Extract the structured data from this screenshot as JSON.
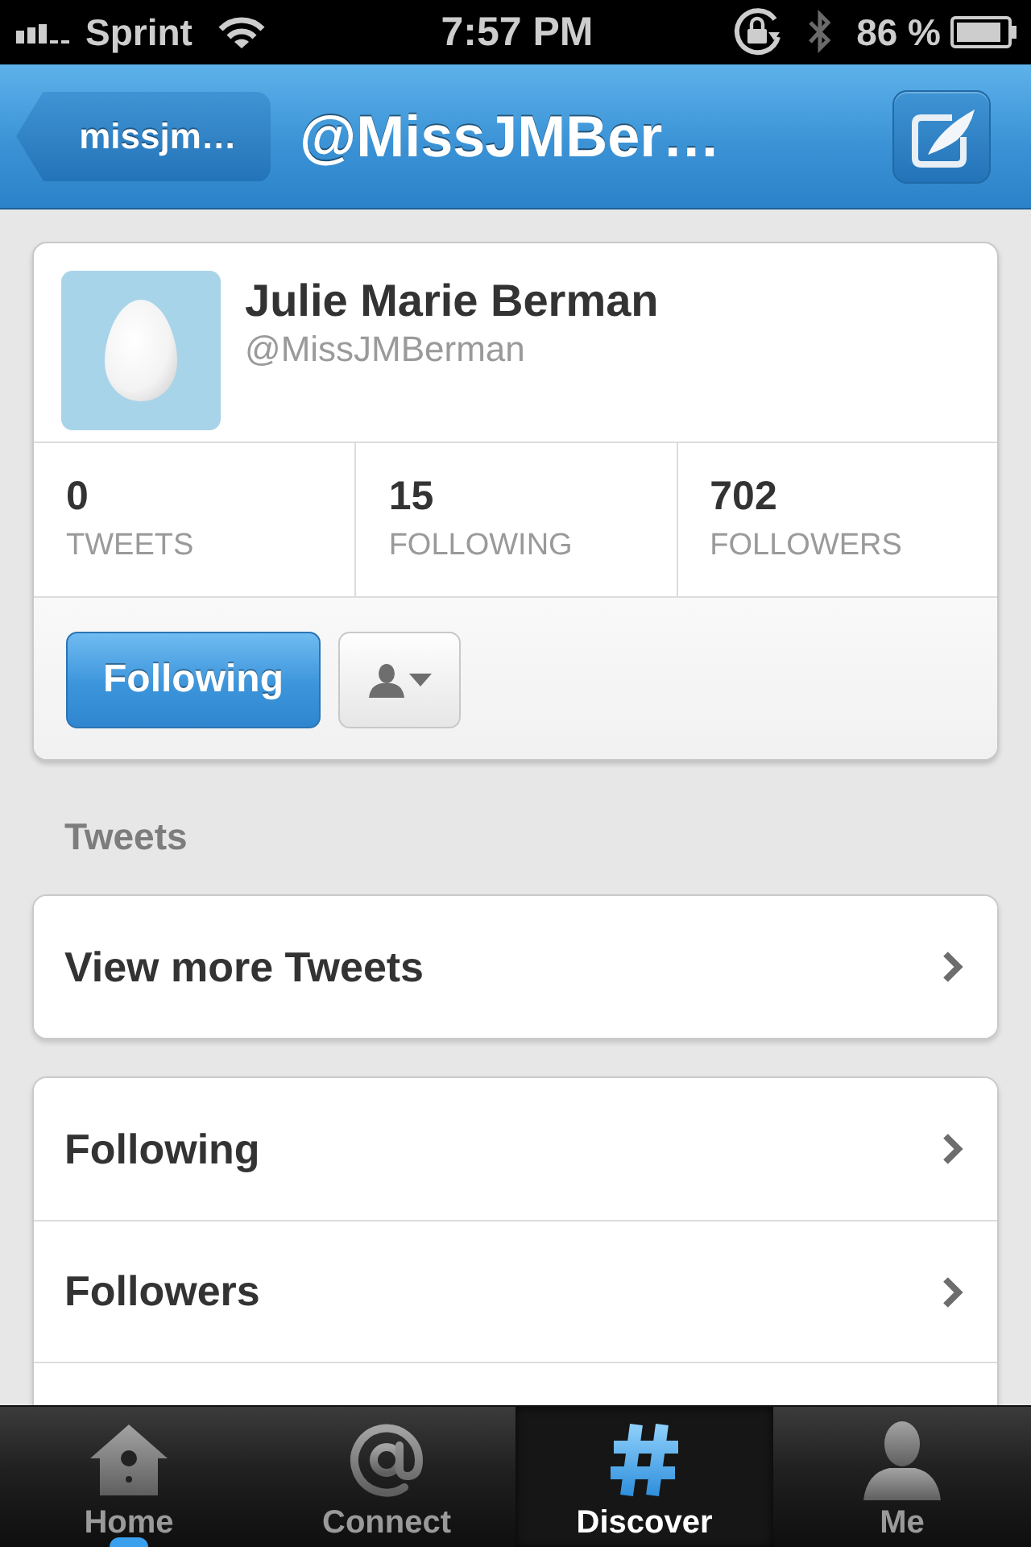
{
  "status_bar": {
    "carrier": "Sprint",
    "time": "7:57 PM",
    "battery": "86 %"
  },
  "nav_bar": {
    "back_button": "missjm…",
    "title": "@MissJMBer…"
  },
  "profile": {
    "name": "Julie Marie Berman",
    "handle": "@MissJMBerman",
    "stats": [
      {
        "value": "0",
        "label": "TWEETS"
      },
      {
        "value": "15",
        "label": "FOLLOWING"
      },
      {
        "value": "702",
        "label": "FOLLOWERS"
      }
    ],
    "follow_button": "Following"
  },
  "tweets_section": {
    "heading": "Tweets",
    "rows": [
      "View more Tweets"
    ]
  },
  "lists": {
    "rows": [
      "Following",
      "Followers"
    ]
  },
  "tab_bar": [
    {
      "kind": "home",
      "label": "Home",
      "selected": false,
      "unread": true
    },
    {
      "kind": "connect",
      "label": "Connect",
      "selected": false,
      "unread": false
    },
    {
      "kind": "discover",
      "label": "Discover",
      "selected": true,
      "unread": false
    },
    {
      "kind": "me",
      "label": "Me",
      "selected": false,
      "unread": false
    }
  ]
}
